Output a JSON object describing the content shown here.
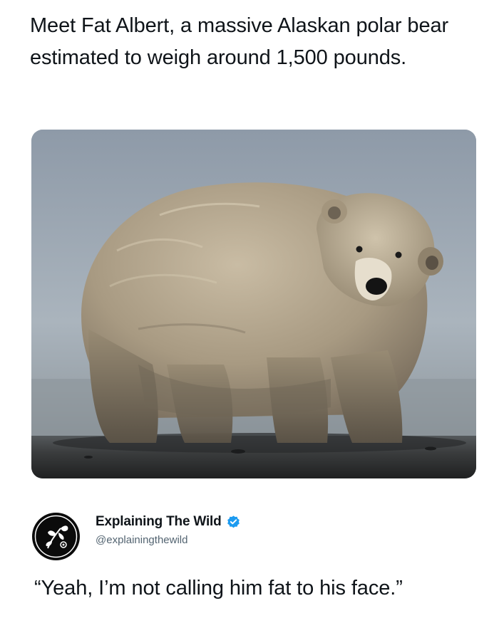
{
  "post": {
    "text": "Meet Fat Albert, a massive Alaskan polar bear estimated to weigh around 1,500 pounds."
  },
  "media": {
    "alt": "polar bear"
  },
  "quoted_post": {
    "account_name": "Explaining The Wild",
    "handle": "@explainingthewild",
    "verified": true,
    "verified_color": "#1d9bf0",
    "avatar_icon": "leaf-branch-icon",
    "text": "“Yeah, I’m not calling him fat to his face.”"
  }
}
